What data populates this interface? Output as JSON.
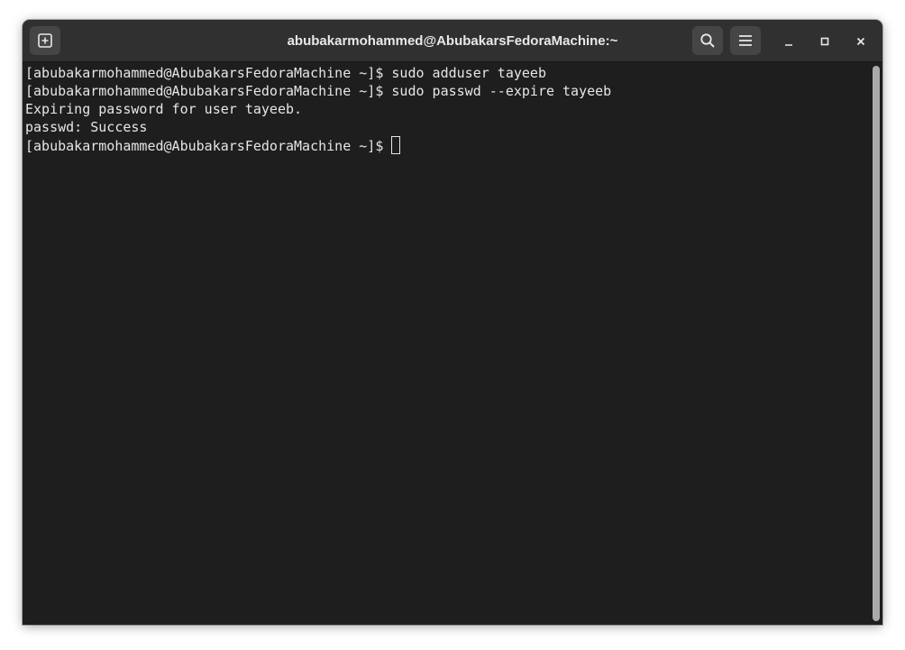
{
  "window": {
    "title": "abubakarmohammed@AbubakarsFedoraMachine:~"
  },
  "header": {
    "new_tab_icon": "new-tab-icon",
    "search_icon": "search-icon",
    "menu_icon": "hamburger-menu-icon",
    "minimize_icon": "minimize-icon",
    "maximize_icon": "maximize-icon",
    "close_icon": "close-icon"
  },
  "terminal": {
    "lines": [
      "[abubakarmohammed@AbubakarsFedoraMachine ~]$ sudo adduser tayeeb",
      "[abubakarmohammed@AbubakarsFedoraMachine ~]$ sudo passwd --expire tayeeb",
      "Expiring password for user tayeeb.",
      "passwd: Success",
      "[abubakarmohammed@AbubakarsFedoraMachine ~]$ "
    ]
  },
  "colors": {
    "background": "#1e1e1e",
    "headerbar": "#303030",
    "text": "#e6e6e6"
  }
}
